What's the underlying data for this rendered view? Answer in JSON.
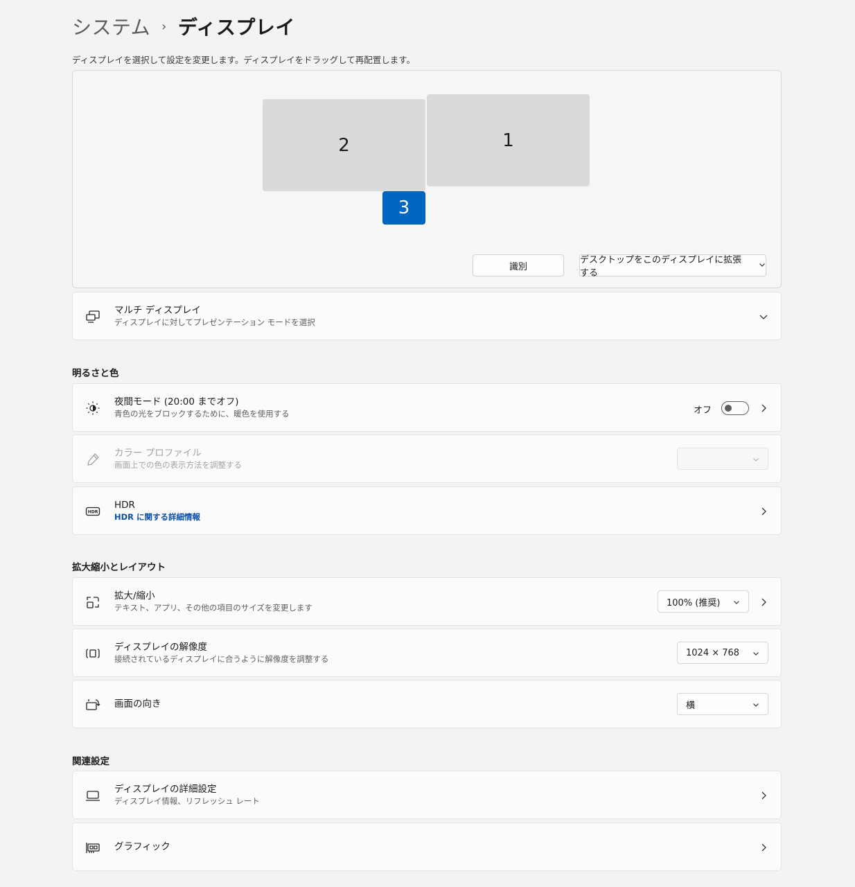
{
  "header": {
    "parent": "システム",
    "separator": "›",
    "current": "ディスプレイ"
  },
  "arrange": {
    "hint": "ディスプレイを選択して設定を変更します。ディスプレイをドラッグして再配置します。",
    "monitors": [
      {
        "label": "2",
        "selected": false
      },
      {
        "label": "1",
        "selected": false
      },
      {
        "label": "3",
        "selected": true
      }
    ],
    "identify_label": "識別",
    "extend_label": "デスクトップをこのディスプレイに拡張する"
  },
  "multi_display": {
    "title": "マルチ ディスプレイ",
    "subtitle": "ディスプレイに対してプレゼンテーション モードを選択",
    "icon": "multi-display-icon"
  },
  "brightness_section": {
    "title": "明るさと色"
  },
  "night_light": {
    "title": "夜間モード (20:00 までオフ)",
    "subtitle": "青色の光をブロックするために、暖色を使用する",
    "toggle_label": "オフ",
    "toggle_on": false,
    "icon": "night-light-icon"
  },
  "color_profile": {
    "title": "カラー プロファイル",
    "subtitle": "画面上での色の表示方法を調整する",
    "value": "",
    "disabled": true,
    "icon": "eyedropper-icon"
  },
  "hdr": {
    "title": "HDR",
    "link": "HDR に関する詳細情報",
    "icon": "hdr-icon"
  },
  "scale_section": {
    "title": "拡大縮小とレイアウト"
  },
  "scale": {
    "title": "拡大/縮小",
    "subtitle": "テキスト、アプリ、その他の項目のサイズを変更します",
    "value": "100% (推奨)",
    "icon": "scale-icon"
  },
  "resolution": {
    "title": "ディスプレイの解像度",
    "subtitle": "接続されているディスプレイに合うように解像度を調整する",
    "value": "1024 × 768",
    "icon": "resolution-icon"
  },
  "orientation": {
    "title": "画面の向き",
    "value": "横",
    "icon": "orientation-icon"
  },
  "related_section": {
    "title": "関連設定"
  },
  "advanced_display": {
    "title": "ディスプレイの詳細設定",
    "subtitle": "ディスプレイ情報、リフレッシュ レート",
    "icon": "laptop-icon"
  },
  "graphics": {
    "title": "グラフィック",
    "icon": "graphics-card-icon"
  },
  "colors": {
    "accent": "#0067c0",
    "link": "#0a4fa8",
    "background": "#f3f3f3"
  }
}
